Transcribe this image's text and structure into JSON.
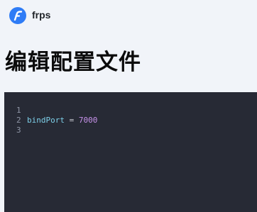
{
  "app": {
    "name": "frps",
    "logo_icon": "frps-logo-icon",
    "accent": "#2f7cf6"
  },
  "page": {
    "title": "编辑配置文件"
  },
  "editor": {
    "background": "#272a35",
    "lines": [
      {
        "number": "1",
        "key": "bindPort",
        "op": " = ",
        "value": "7000"
      },
      {
        "number": "2",
        "key": "",
        "op": "",
        "value": ""
      },
      {
        "number": "3",
        "key": "",
        "op": "",
        "value": ""
      }
    ]
  }
}
